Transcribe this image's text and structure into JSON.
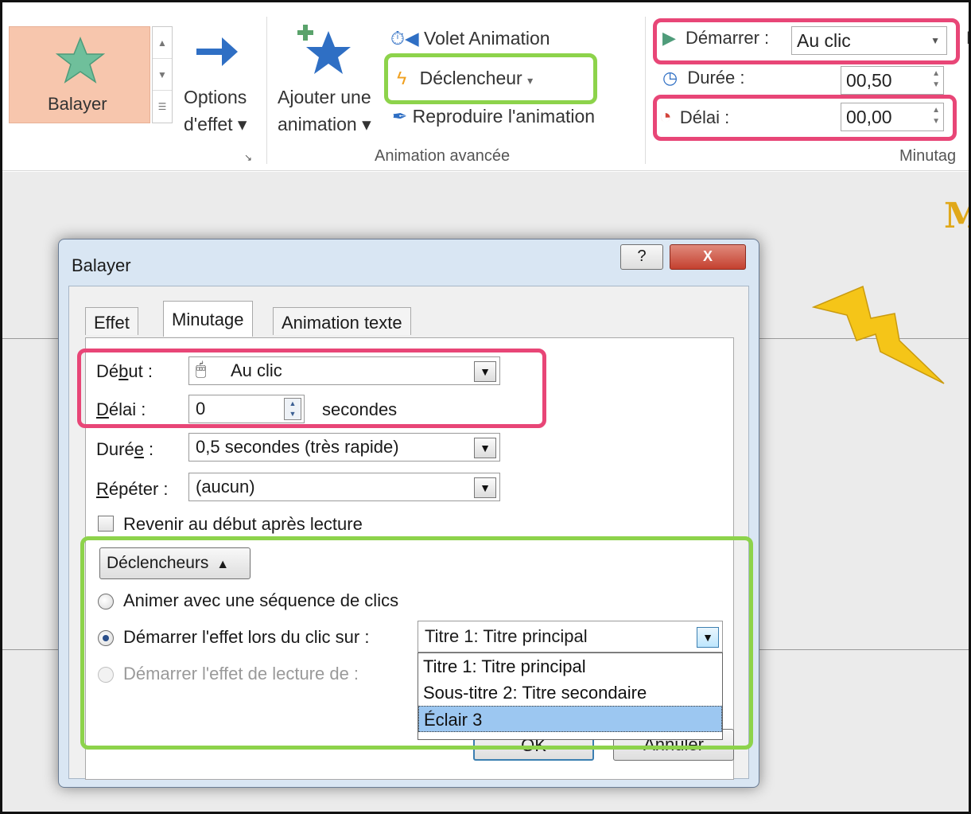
{
  "ribbon": {
    "effect_name": "Balayer",
    "options_label_1": "Options",
    "options_label_2": "d'effet",
    "add_label_1": "Ajouter une",
    "add_label_2": "animation",
    "volet_label": "Volet Animation",
    "trigger_label": "Déclencheur",
    "reproduce_label": "Reproduire l'animation",
    "advanced_group": "Animation avancée",
    "start_label": "Démarrer :",
    "start_value": "Au clic",
    "duration_label": "Durée :",
    "duration_value": "00,50",
    "delay_label": "Délai :",
    "delay_value": "00,00",
    "timing_group": "Minutag",
    "cut_letter": "F"
  },
  "slide": {
    "title_fragment": "M"
  },
  "dialog": {
    "title": "Balayer",
    "help_label": "?",
    "close_label": "X",
    "tabs": [
      "Effet",
      "Minutage",
      "Animation texte"
    ],
    "start_label": "Début :",
    "start_value": "Au clic",
    "delay_label": "Délai :",
    "delay_value": "0",
    "delay_unit": "secondes",
    "duration_label": "Durée :",
    "duration_value": "0,5 secondes (très rapide)",
    "repeat_label": "Répéter :",
    "repeat_value": "(aucun)",
    "rewind_label": "Revenir au début après lecture",
    "triggers_button": "Déclencheurs",
    "radio_sequence": "Animer avec une séquence de clics",
    "radio_click": "Démarrer l'effet lors du clic sur :",
    "radio_play": "Démarrer l'effet de lecture de :",
    "click_target_value": "Titre 1: Titre principal",
    "dropdown_options": [
      "Titre 1: Titre principal",
      "Sous-titre 2: Titre secondaire",
      "Éclair 3"
    ],
    "ok_label": "OK",
    "cancel_label": "Annuler"
  },
  "colors": {
    "pink_highlight": "#e84677",
    "green_highlight": "#8dd34b",
    "tile_background": "#f7c6ad",
    "lightning": "#f5c518",
    "arrow_blue": "#2f6fc4"
  }
}
